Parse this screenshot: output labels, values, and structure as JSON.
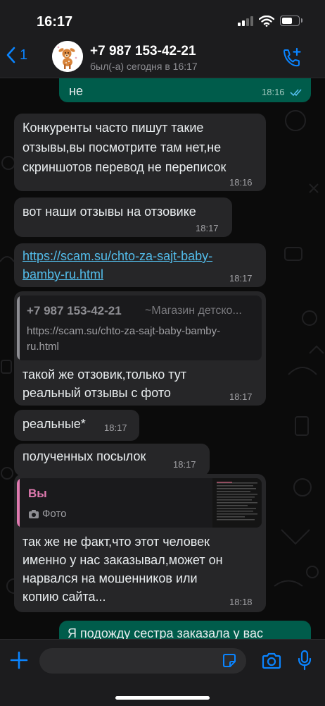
{
  "status_bar": {
    "time": "16:17"
  },
  "header": {
    "back_count": "1",
    "contact_name": "+7 987 153-42-21",
    "last_seen": "был(-а) сегодня в 16:17"
  },
  "messages": [
    {
      "dir": "out",
      "text": "не",
      "time": "18:16"
    },
    {
      "dir": "in",
      "lines": [
        "Конкуренты часто пишут такие",
        "отзывы,вы посмотрите там нет,не",
        "скриншотов перевод не переписок"
      ],
      "time": "18:16"
    },
    {
      "dir": "in",
      "text": "вот наши отзывы на отзовике",
      "time": "18:17"
    },
    {
      "dir": "in",
      "link_lines": [
        "https://scam.su/chto-za-sajt-baby-",
        "bamby-ru.html"
      ],
      "time": "18:17"
    },
    {
      "dir": "in",
      "quote": {
        "author": "+7 987 153-42-21",
        "author_note": "~Магазин детско...",
        "lines": [
          "https://scam.su/chto-za-sajt-baby-bamby-",
          "ru.html"
        ]
      },
      "lines": [
        "такой же отзовик,только тут",
        "реальный отзывы с фото"
      ],
      "time": "18:17"
    },
    {
      "dir": "in",
      "text": "реальные*",
      "time": "18:17"
    },
    {
      "dir": "in",
      "text": "полученных посылок",
      "time": "18:17"
    },
    {
      "dir": "in",
      "quote": {
        "author": "Вы",
        "media_label": "Фото"
      },
      "lines": [
        "так же не факт,что этот человек",
        "именно у нас заказывал,может он",
        "нарвался на мошенников или",
        "копию сайта..."
      ],
      "time": "18:18"
    },
    {
      "dir": "out",
      "text": "Я подожду сестра заказала у вас"
    }
  ],
  "colors": {
    "accent": "#0a84ff",
    "incoming": "#262628",
    "outgoing": "#005c4b",
    "link": "#53bdeb",
    "read_ticks": "#53bdeb"
  },
  "icons": [
    "back-chevron-icon",
    "add-call-icon",
    "plus-icon",
    "sticker-icon",
    "camera-icon",
    "microphone-icon"
  ]
}
